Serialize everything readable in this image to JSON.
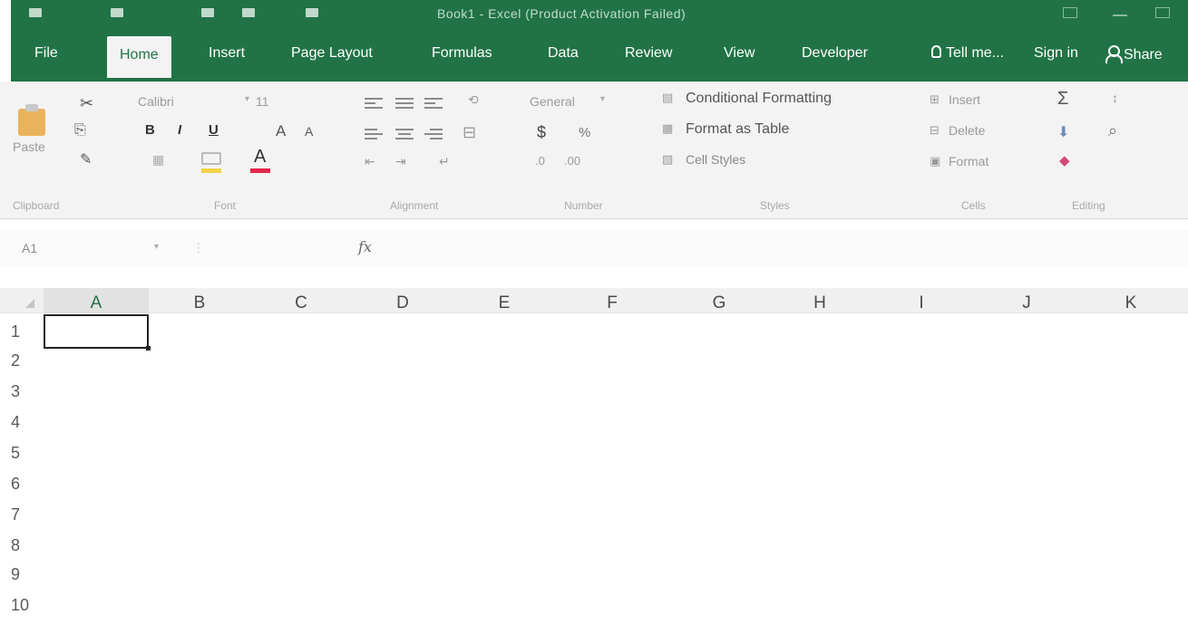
{
  "window": {
    "title": "Book1 - Excel (Product Activation Failed)"
  },
  "tabs": [
    {
      "label": "File"
    },
    {
      "label": "Home",
      "active": true
    },
    {
      "label": "Insert"
    },
    {
      "label": "Page Layout"
    },
    {
      "label": "Formulas"
    },
    {
      "label": "Data"
    },
    {
      "label": "Review"
    },
    {
      "label": "View"
    },
    {
      "label": "Developer"
    }
  ],
  "tell_me": "Tell me...",
  "sign_in": "Sign in",
  "share": "Share",
  "ribbon": {
    "clipboard": {
      "paste": "Paste",
      "label": "Clipboard"
    },
    "font": {
      "name": "Calibri",
      "size": "11",
      "bold": "B",
      "italic": "I",
      "underline": "U",
      "grow": "A",
      "shrink": "A",
      "font_color_glyph": "A",
      "label": "Font"
    },
    "alignment": {
      "label": "Alignment"
    },
    "number": {
      "format": "General",
      "currency": "$",
      "percent": "%",
      "label": "Number"
    },
    "styles": {
      "conditional": "Conditional Formatting",
      "format_table": "Format as Table",
      "cell_styles": "Cell Styles",
      "label": "Styles"
    },
    "cells": {
      "insert": "Insert",
      "delete": "Delete",
      "format": "Format",
      "label": "Cells"
    },
    "editing": {
      "autosum": "Σ",
      "label": "Editing"
    }
  },
  "formula_bar": {
    "name_box": "A1",
    "fx": "fx",
    "value": ""
  },
  "columns": [
    "A",
    "B",
    "C",
    "D",
    "E",
    "F",
    "G",
    "H",
    "I",
    "J",
    "K"
  ],
  "rows": [
    "1",
    "2",
    "3",
    "4",
    "5",
    "6",
    "7",
    "8",
    "9",
    "10"
  ],
  "active_cell": "A1",
  "colors": {
    "brand_green": "#217346",
    "ribbon_bg": "#f3f3f3",
    "font_color": "#e3254b",
    "fill_color": "#f3d34a"
  }
}
